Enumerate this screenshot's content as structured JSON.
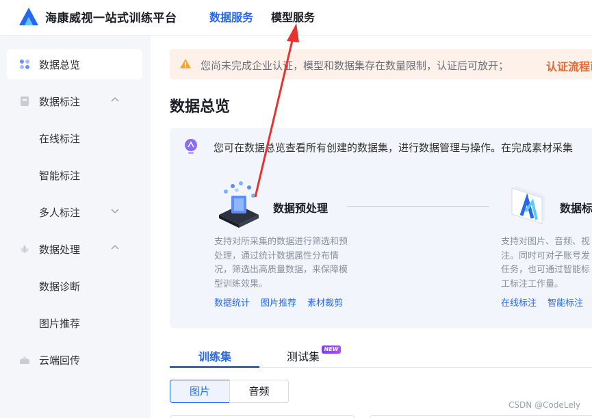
{
  "header": {
    "brand": "海康威视一站式训练平台",
    "nav": [
      {
        "label": "数据服务",
        "active": true
      },
      {
        "label": "模型服务",
        "active": false
      }
    ]
  },
  "sidebar": {
    "items": [
      {
        "label": "数据总览",
        "icon": "grid-icon",
        "active": true
      },
      {
        "label": "数据标注",
        "icon": "tag-icon",
        "expanded": true
      },
      {
        "label": "在线标注",
        "sub": true
      },
      {
        "label": "智能标注",
        "sub": true
      },
      {
        "label": "多人标注",
        "sub": true,
        "collapsed": true
      },
      {
        "label": "数据处理",
        "icon": "lotus-icon",
        "expanded": true
      },
      {
        "label": "数据诊断",
        "sub": true
      },
      {
        "label": "图片推荐",
        "sub": true
      },
      {
        "label": "云端回传",
        "icon": "cloud-upload-icon"
      }
    ]
  },
  "alert": {
    "text": "您尚未完成企业认证，模型和数据集存在数量限制，认证后可放开；",
    "link": "认证流程已大"
  },
  "page": {
    "title": "数据总览"
  },
  "overview": {
    "description": "您可在数据总览查看所有创建的数据集，进行数据管理与操作。在完成素材采集",
    "steps": [
      {
        "title": "数据预处理",
        "text_lines": [
          "支持对所采集的数据进行筛选和预",
          "处理，通过统计数据属性分布情",
          "况，筛选出高质量数据，来保障模",
          "型训练效果。"
        ],
        "links": [
          "数据统计",
          "图片推荐",
          "素材裁剪"
        ]
      },
      {
        "title": "数据标",
        "text_lines": [
          "支持对图片、音频、视",
          "注。同时可对子账号发",
          "任务，也可通过智能标",
          "工标注工作量。"
        ],
        "links": [
          "在线标注",
          "智能标注"
        ]
      }
    ]
  },
  "tabs": {
    "train": "训练集",
    "test": "测试集",
    "new_badge": "NEW"
  },
  "segments": {
    "image": "图片",
    "audio": "音频"
  },
  "watermark": "CSDN @CodeLely",
  "colors": {
    "accent": "#2468f2",
    "warning": "#f0662f",
    "annotation_arrow": "#e8322e"
  }
}
